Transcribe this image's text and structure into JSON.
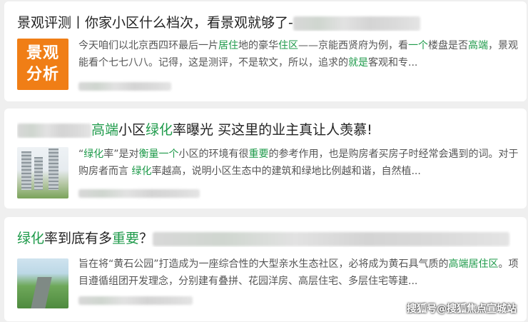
{
  "cards": [
    {
      "title_prefix": "景观评测丨你家小区什么档次，看景观就够了-",
      "badge_line1": "景观",
      "badge_line2": "分析",
      "desc": [
        {
          "t": "今天咱们以北京西四环最后一片",
          "h": false
        },
        {
          "t": "居住",
          "h": true
        },
        {
          "t": "地的豪华",
          "h": false
        },
        {
          "t": "住区",
          "h": true
        },
        {
          "t": "——京能西贤府为例，看",
          "h": false
        },
        {
          "t": "一个",
          "h": true
        },
        {
          "t": "楼盘是否",
          "h": false
        },
        {
          "t": "高端",
          "h": true
        },
        {
          "t": "，景观能看个七七八八。记得，这是测评，不是软文，所以，追求的",
          "h": false
        },
        {
          "t": "就是",
          "h": true
        },
        {
          "t": "客观和专...",
          "h": false
        }
      ]
    },
    {
      "title_parts": [
        {
          "t": "高端",
          "h": true
        },
        {
          "t": "小区",
          "h": false
        },
        {
          "t": "绿化",
          "h": true
        },
        {
          "t": "率曝光 买这里的业主真让人羡慕!",
          "h": false
        }
      ],
      "desc": [
        {
          "t": "“",
          "h": false
        },
        {
          "t": "绿化",
          "h": true
        },
        {
          "t": "率”是对",
          "h": false
        },
        {
          "t": "衡量",
          "h": true
        },
        {
          "t": "一个",
          "h": true
        },
        {
          "t": "小区的环境有很",
          "h": false
        },
        {
          "t": "重要",
          "h": true
        },
        {
          "t": "的参考作用，也是购房者买房子时经常会遇到的词。对于购房者而言 ",
          "h": false
        },
        {
          "t": "绿化",
          "h": true
        },
        {
          "t": "率越高，说明小区生态中的建筑和绿地比例越和谐，自然植...",
          "h": false
        }
      ]
    },
    {
      "title_parts": [
        {
          "t": "绿化",
          "h": true
        },
        {
          "t": "率到底有多",
          "h": false
        },
        {
          "t": "重要",
          "h": true
        },
        {
          "t": "？",
          "h": false
        }
      ],
      "desc": [
        {
          "t": "旨在将“黄石公园”打造成为一座综合性的大型亲水生态社区，必将成为黄石具气质的",
          "h": false
        },
        {
          "t": "高端",
          "h": true
        },
        {
          "t": "居住区",
          "h": true
        },
        {
          "t": "。项目遵循组团开发理念，分别建有叠拼、花园洋房、高层住宅、多层住宅等建...",
          "h": false
        }
      ]
    }
  ],
  "watermark": "搜狐号@搜狐焦点宣城站",
  "colors": {
    "highlight": "#1e9a4a",
    "badge": "#f07e16",
    "text": "#222222",
    "desc": "#555555"
  }
}
